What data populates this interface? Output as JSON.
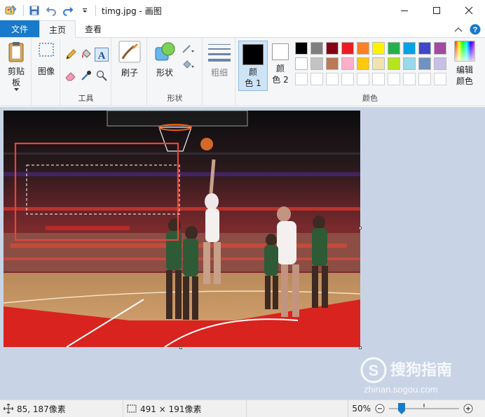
{
  "window": {
    "title": "timg.jpg - 画图"
  },
  "tabs": {
    "file": "文件",
    "home": "主页",
    "view": "查看"
  },
  "ribbon": {
    "clipboard": {
      "label": "剪贴板"
    },
    "image": {
      "label": "图像"
    },
    "tools": {
      "group_label": "工具"
    },
    "brush": {
      "label": "刷子"
    },
    "shapes": {
      "label": "形状",
      "group_label": "形状"
    },
    "size": {
      "label": "粗细"
    },
    "color1": {
      "label_line1": "颜",
      "label_line2": "色 1",
      "color": "#000000"
    },
    "color2": {
      "label_line1": "颜",
      "label_line2": "色 2",
      "color": "#ffffff"
    },
    "palette": {
      "group_label": "颜色",
      "row1": [
        "#000000",
        "#7f7f7f",
        "#880015",
        "#ed1c24",
        "#ff7f27",
        "#fff200",
        "#22b14c",
        "#00a2e8",
        "#3f48cc",
        "#a349a4"
      ],
      "row2": [
        "#ffffff",
        "#c3c3c3",
        "#b97a57",
        "#ffaec9",
        "#ffc90e",
        "#efe4b0",
        "#b5e61d",
        "#99d9ea",
        "#7092be",
        "#c8bfe7"
      ]
    },
    "edit_colors": {
      "line1": "编辑",
      "line2": "颜色"
    }
  },
  "status": {
    "cursor_position": "85, 187像素",
    "selection_size": "491 × 191像素",
    "zoom": "50%",
    "zoom_fraction": 0.5
  },
  "watermark": {
    "brand": "搜狗指南",
    "url": "zhinan.sogou.com"
  }
}
